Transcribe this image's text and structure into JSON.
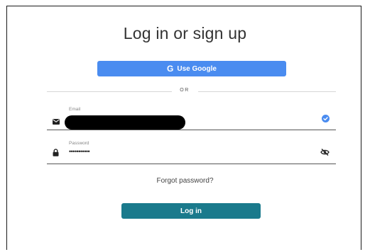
{
  "dialog": {
    "title": "Log in or sign up"
  },
  "google_button": {
    "icon": "G",
    "label": "Use Google",
    "color": "#4a8cf0"
  },
  "divider": {
    "text": "OR"
  },
  "email_field": {
    "label": "Email",
    "lead_icon": "envelope-icon",
    "trail_icon": "check-circle-icon",
    "check_color": "#4a8cf0"
  },
  "password_field": {
    "label": "Password",
    "value": "•••••••••••",
    "lead_icon": "lock-icon",
    "trail_icon": "eye-slash-icon"
  },
  "forgot_link": {
    "label": "Forgot password?"
  },
  "login_button": {
    "label": "Log in",
    "color": "#1a7a8c"
  }
}
